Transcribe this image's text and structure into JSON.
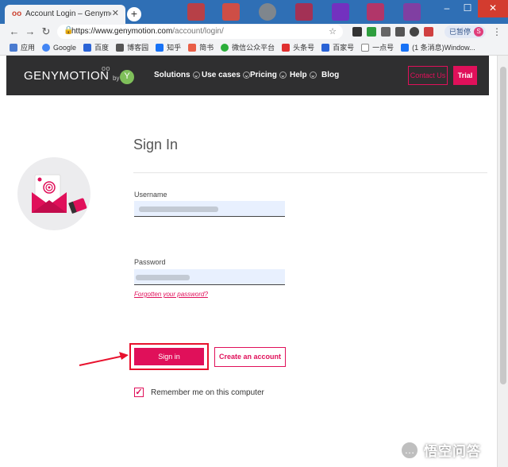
{
  "browser": {
    "tab_title": "Account Login – Genymotion ...",
    "tab_favicon": "genymotion-favicon",
    "new_tab_symbol": "+",
    "url_host": "https://www.genymotion.com",
    "url_path": "/account/login/",
    "profile_status": "已暂停",
    "profile_initial": "S",
    "bookmarks": [
      "应用",
      "Google",
      "百度",
      "博客园",
      "知乎",
      "简书",
      "微信公众平台",
      "头条号",
      "百家号",
      "一点号",
      "(1 条消息)Window..."
    ]
  },
  "site": {
    "logo": "GENYMOTION",
    "logo_sup": "oo",
    "logo_by": "by",
    "menu": [
      {
        "label": "Solutions"
      },
      {
        "label": "Use cases"
      },
      {
        "label": "Pricing"
      },
      {
        "label": "Help"
      },
      {
        "label": "Blog"
      }
    ],
    "contact_label": "Contact Us",
    "trial_label": "Trial",
    "accent_color": "#e0105a"
  },
  "form": {
    "title": "Sign In",
    "username_label": "Username",
    "password_label": "Password",
    "forgot_link": "Forgotten your password?",
    "signin_button": "Sign in",
    "create_button": "Create an account",
    "remember_label": "Remember me on this computer",
    "remember_checked": true
  },
  "watermark": {
    "text": "悟空问答",
    "icon": "chat-bubble-icon"
  }
}
